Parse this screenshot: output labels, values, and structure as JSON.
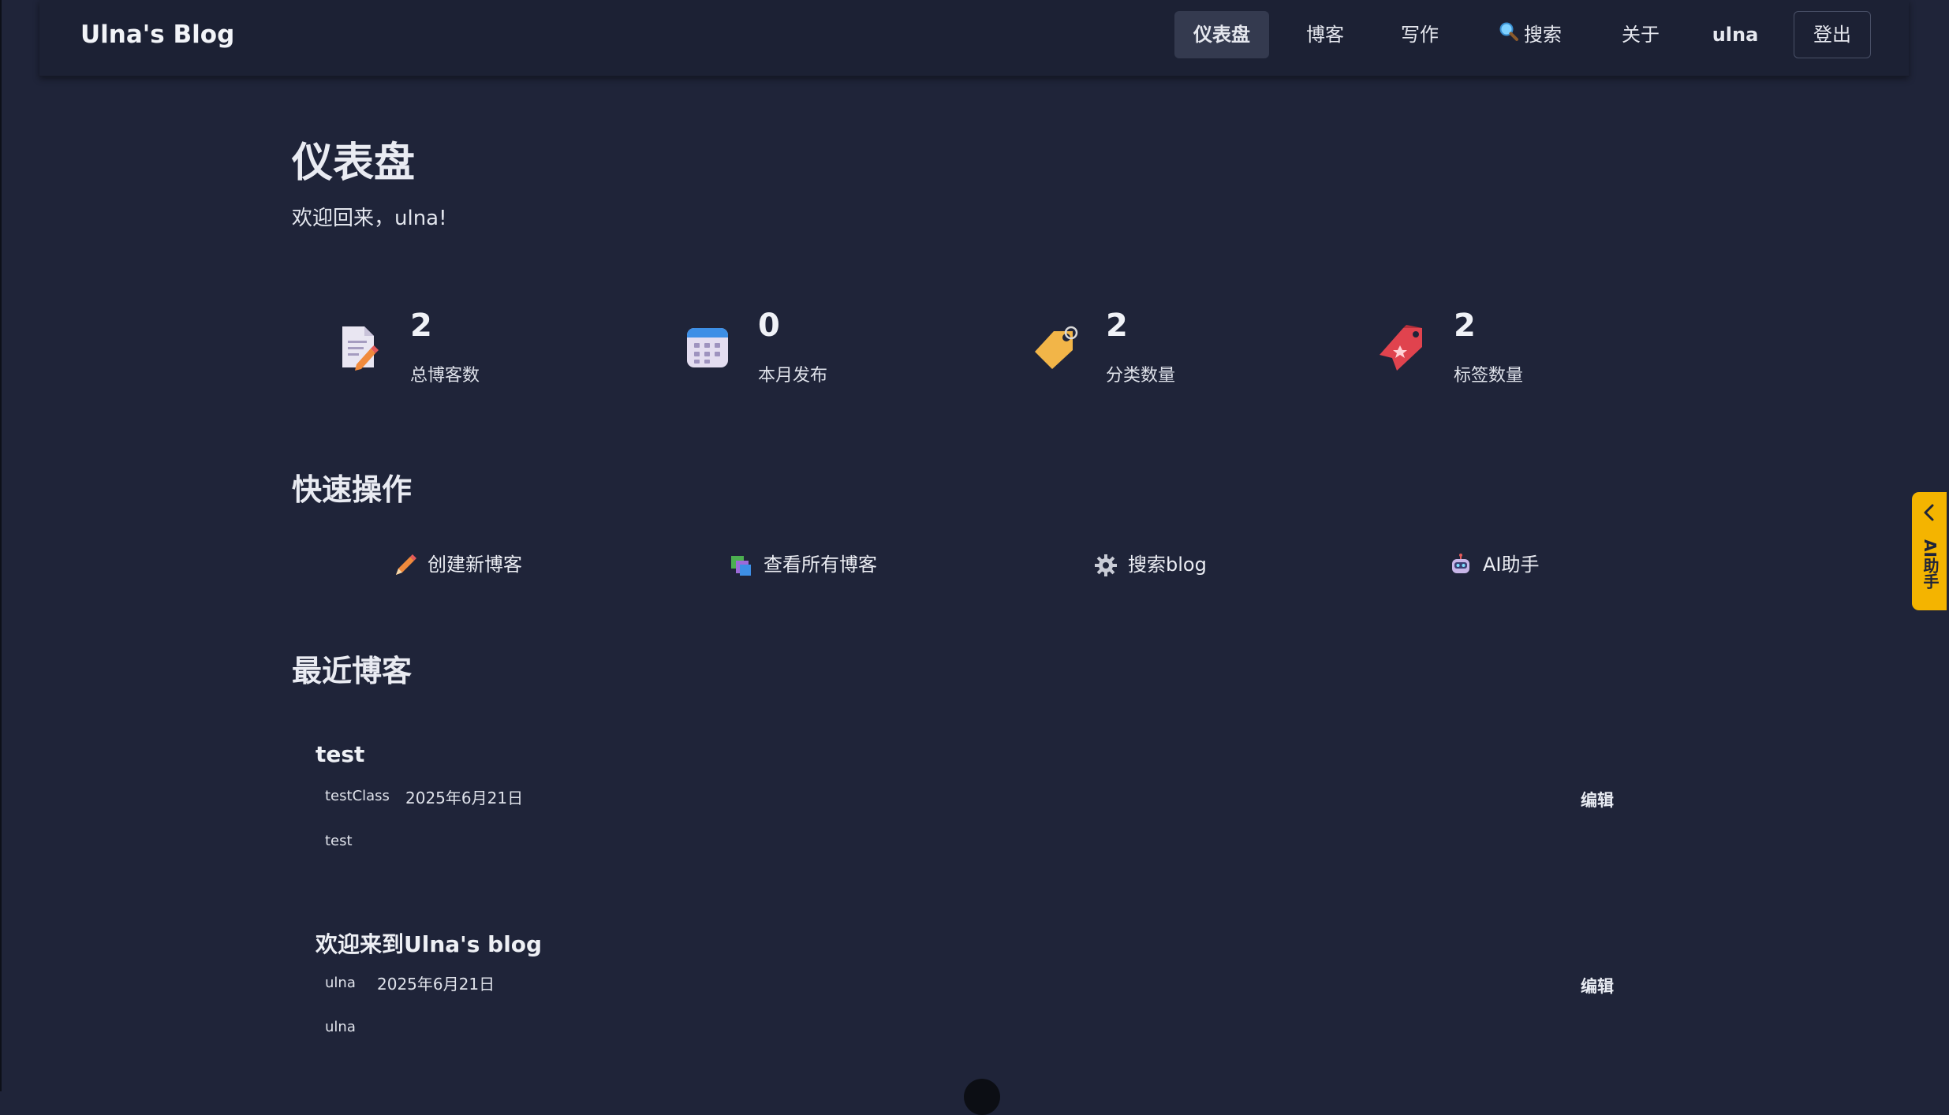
{
  "header": {
    "brand": "Ulna's Blog",
    "nav": {
      "dashboard": "仪表盘",
      "blog": "博客",
      "write": "写作",
      "search": "搜索",
      "about": "关于",
      "user": "ulna",
      "logout": "登出"
    }
  },
  "page": {
    "title": "仪表盘",
    "welcome": "欢迎回来，ulna!"
  },
  "stats": [
    {
      "icon": "document-edit-icon",
      "value": "2",
      "label": "总博客数"
    },
    {
      "icon": "calendar-icon",
      "value": "0",
      "label": "本月发布"
    },
    {
      "icon": "price-tag-icon",
      "value": "2",
      "label": "分类数量"
    },
    {
      "icon": "bookmark-tag-icon",
      "value": "2",
      "label": "标签数量"
    }
  ],
  "quick_actions": {
    "title": "快速操作",
    "items": [
      {
        "icon": "pencil-icon",
        "label": "创建新博客"
      },
      {
        "icon": "cards-icon",
        "label": "查看所有博客"
      },
      {
        "icon": "gear-icon",
        "label": "搜索blog"
      },
      {
        "icon": "robot-icon",
        "label": "AI助手"
      }
    ]
  },
  "recent": {
    "title": "最近博客",
    "posts": [
      {
        "title": "test",
        "category": "testClass",
        "date": "2025年6月21日",
        "tag": "test",
        "edit": "编辑"
      },
      {
        "title": "欢迎来到Ulna's blog",
        "category": "ulna",
        "date": "2025年6月21日",
        "tag": "ulna",
        "edit": "编辑"
      }
    ]
  },
  "ai_tab": {
    "label": "AI助手"
  },
  "colors": {
    "background": "#1f2439",
    "header": "#1c2134",
    "active_nav": "#343a4f",
    "ai_tab": "#f4b400"
  }
}
